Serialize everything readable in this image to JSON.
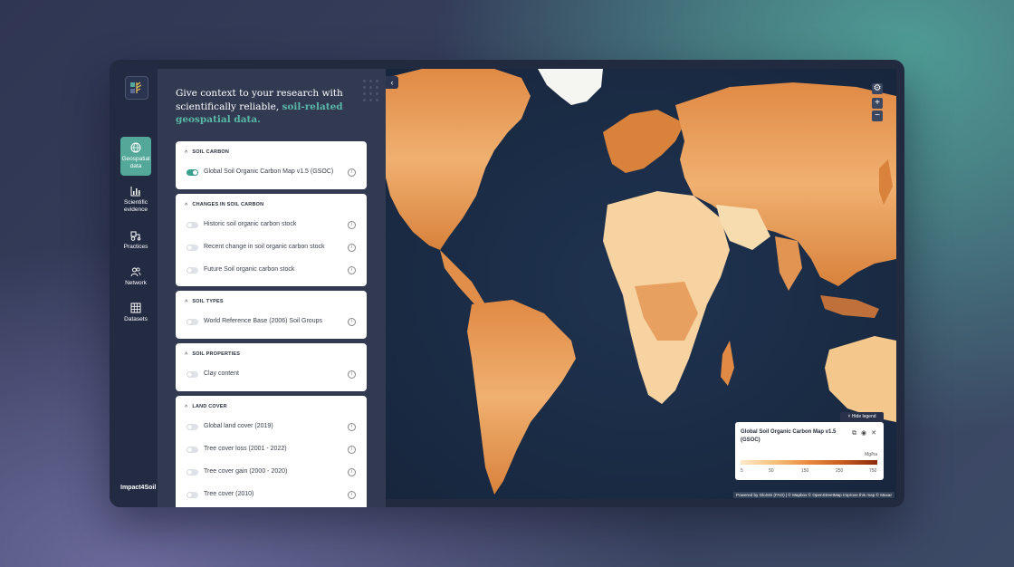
{
  "headline": {
    "text_plain": "Give context to your research with scientifically reliable, ",
    "text_highlight": "soil-related geospatial data."
  },
  "nav": {
    "items": [
      {
        "label": "Geospatial data",
        "icon": "globe-icon",
        "active": true
      },
      {
        "label": "Scientific evidence",
        "icon": "bar-chart-icon",
        "active": false
      },
      {
        "label": "Practices",
        "icon": "tractor-icon",
        "active": false
      },
      {
        "label": "Network",
        "icon": "users-icon",
        "active": false
      },
      {
        "label": "Datasets",
        "icon": "table-icon",
        "active": false
      }
    ],
    "brand": "Impact4Soil"
  },
  "sections": [
    {
      "title": "SOIL CARBON",
      "layers": [
        {
          "label": "Global Soil Organic Carbon Map v1.5 (GSOC)",
          "enabled": true
        }
      ]
    },
    {
      "title": "CHANGES IN SOIL CARBON",
      "layers": [
        {
          "label": "Historic soil organic carbon stock",
          "enabled": false
        },
        {
          "label": "Recent change in soil organic carbon stock",
          "enabled": false
        },
        {
          "label": "Future Soil organic carbon stock",
          "enabled": false
        }
      ]
    },
    {
      "title": "SOIL TYPES",
      "layers": [
        {
          "label": "World Reference Base (2006) Soil Groups",
          "enabled": false
        }
      ]
    },
    {
      "title": "SOIL PROPERTIES",
      "layers": [
        {
          "label": "Clay content",
          "enabled": false
        }
      ]
    },
    {
      "title": "LAND COVER",
      "layers": [
        {
          "label": "Global land cover (2019)",
          "enabled": false
        },
        {
          "label": "Tree cover loss (2001 - 2022)",
          "enabled": false
        },
        {
          "label": "Tree cover gain (2000 - 2020)",
          "enabled": false
        },
        {
          "label": "Tree cover (2010)",
          "enabled": false
        }
      ]
    }
  ],
  "map": {
    "zoom_in": "+",
    "zoom_out": "−",
    "hide_legend": "Hide legend",
    "legend": {
      "title": "Global Soil Organic Carbon Map v1.5 (GSOC)",
      "unit": "Mg/ha",
      "ticks": [
        "5",
        "50",
        "150",
        "250",
        "750"
      ]
    },
    "attribution": "Powered by GloSIS (FAO) | © Mapbox © OpenStreetMap  Improve this map © Maxar"
  },
  "colors": {
    "accent": "#53a89a",
    "highlight_text": "#59b8a7",
    "panel_bg": "#323a52",
    "nav_bg": "#232b42",
    "toggle_on": "#3aa08f"
  }
}
